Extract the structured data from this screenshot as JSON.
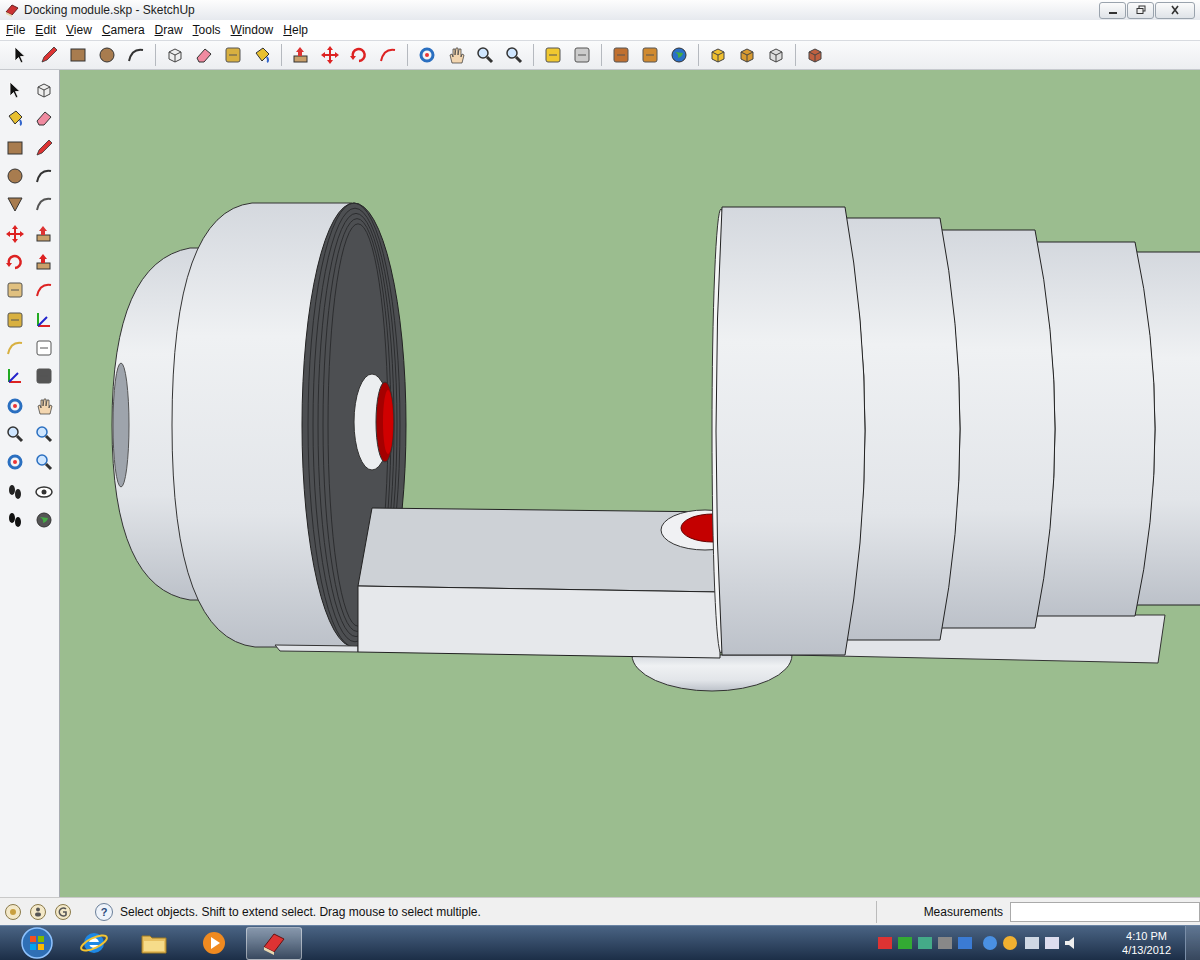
{
  "window": {
    "title": "Docking module.skp - SketchUp"
  },
  "menu": [
    "File",
    "Edit",
    "View",
    "Camera",
    "Draw",
    "Tools",
    "Window",
    "Help"
  ],
  "status_bar": {
    "help_icon": "?",
    "hint": "Select objects. Shift to extend select. Drag mouse to select multiple.",
    "measurements_label": "Measurements",
    "measurements_value": ""
  },
  "taskbar": {
    "time": "4:10 PM",
    "date": "4/13/2012"
  }
}
